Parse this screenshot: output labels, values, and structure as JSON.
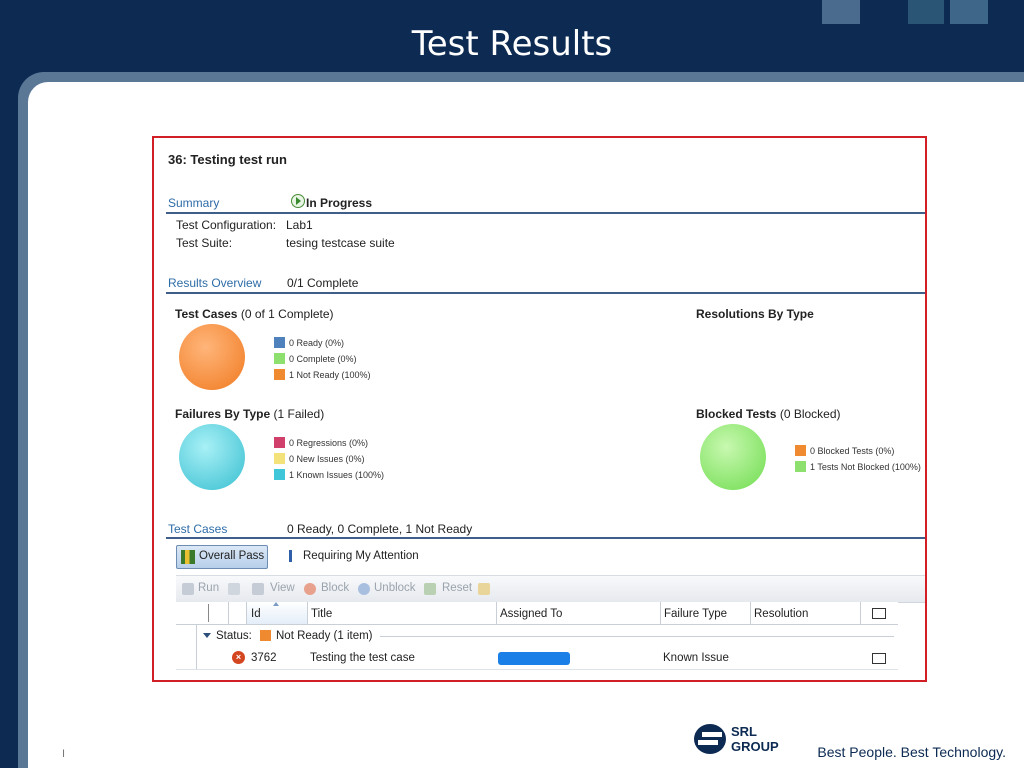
{
  "slide": {
    "title": "Test Results",
    "page_mark": "I",
    "footer": {
      "logo_line1": "SRL",
      "logo_line2": "GROUP",
      "tagline": "Best People. Best Technology."
    }
  },
  "run": {
    "title": "36: Testing test run",
    "summary_label": "Summary",
    "status": "In Progress",
    "config_label": "Test Configuration:",
    "config_value": "Lab1",
    "suite_label": "Test Suite:",
    "suite_value": "tesing testcase suite"
  },
  "results_overview": {
    "label": "Results Overview",
    "value": "0/1 Complete"
  },
  "test_cases_chart": {
    "title": "Test Cases",
    "subtitle": "(0 of 1 Complete)",
    "legend": [
      {
        "label": "0 Ready (0%)",
        "color": "#4f81bd"
      },
      {
        "label": "0 Complete (0%)",
        "color": "#8ee06e"
      },
      {
        "label": "1 Not Ready (100%)",
        "color": "#f08a30"
      }
    ]
  },
  "resolutions_chart": {
    "title": "Resolutions By Type"
  },
  "failures_chart": {
    "title": "Failures By Type",
    "subtitle": "(1 Failed)",
    "legend": [
      {
        "label": "0 Regressions (0%)",
        "color": "#d0406a"
      },
      {
        "label": "0 New Issues (0%)",
        "color": "#f3e27a"
      },
      {
        "label": "1 Known Issues (100%)",
        "color": "#3fc6d8"
      }
    ]
  },
  "blocked_chart": {
    "title": "Blocked Tests",
    "subtitle": "(0 Blocked)",
    "legend": [
      {
        "label": "0 Blocked Tests (0%)",
        "color": "#f08a30"
      },
      {
        "label": "1 Tests Not Blocked (100%)",
        "color": "#8ee06e"
      }
    ]
  },
  "test_cases_section": {
    "label": "Test Cases",
    "value": "0 Ready, 0 Complete, 1 Not Ready"
  },
  "filters": {
    "overall_pass": "Overall Pass",
    "requiring_attention": "Requiring My Attention"
  },
  "toolbar": {
    "run": "Run",
    "view": "View",
    "block": "Block",
    "unblock": "Unblock",
    "reset": "Reset"
  },
  "grid": {
    "columns": [
      "Id",
      "Title",
      "Assigned To",
      "Failure Type",
      "Resolution"
    ],
    "group": {
      "label": "Status:",
      "value": "Not Ready (1 item)"
    },
    "rows": [
      {
        "id": "3762",
        "title": "Testing the test case",
        "assigned_to": "",
        "failure_type": "Known Issue",
        "resolution": ""
      }
    ]
  }
}
